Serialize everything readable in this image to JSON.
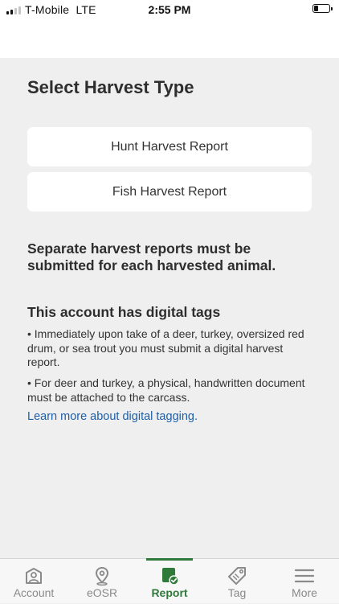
{
  "status_bar": {
    "carrier": "T-Mobile",
    "network": "LTE",
    "time": "2:55 PM"
  },
  "main": {
    "title": "Select Harvest Type",
    "options": [
      {
        "label": "Hunt Harvest Report"
      },
      {
        "label": "Fish Harvest Report"
      }
    ],
    "notice": "Separate harvest reports must be submitted for each harvested animal.",
    "digital_tags": {
      "heading": "This account has digital tags",
      "bullets": [
        "• Immediately upon take of a deer, turkey, oversized red drum, or sea trout you must submit a digital harvest report.",
        "• For deer and turkey, a physical, handwritten document must be attached to the carcass."
      ],
      "link": "Learn more about digital tagging."
    }
  },
  "tab_bar": {
    "active_color": "#2f7a3a",
    "inactive_color": "#8a8a8a",
    "items": [
      {
        "label": "Account",
        "icon": "account-icon"
      },
      {
        "label": "eOSR",
        "icon": "location-pin-icon"
      },
      {
        "label": "Report",
        "icon": "report-check-icon",
        "active": true
      },
      {
        "label": "Tag",
        "icon": "tag-icon"
      },
      {
        "label": "More",
        "icon": "menu-icon"
      }
    ]
  }
}
